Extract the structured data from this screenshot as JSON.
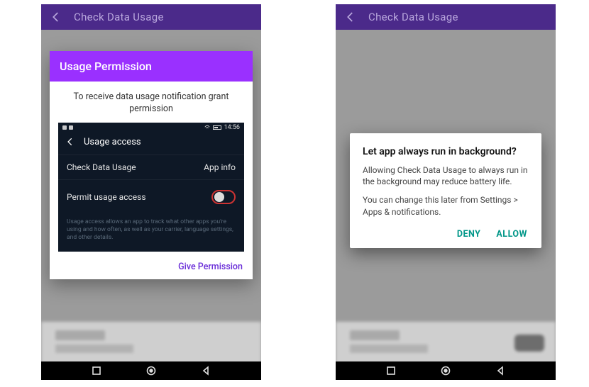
{
  "appbar": {
    "title": "Check Data Usage"
  },
  "left": {
    "dialog": {
      "title": "Usage Permission",
      "description": "To receive data usage notification grant permission",
      "action_label": "Give Permission"
    },
    "embed": {
      "status_time": "14:56",
      "appbar_title": "Usage access",
      "row1_left": "Check Data Usage",
      "row1_right": "App info",
      "row2_left": "Permit usage access",
      "fineprint": "Usage access allows an app to track what other apps you're using and how often, as well as your carrier, language settings, and other details."
    }
  },
  "right": {
    "dialog": {
      "title": "Let app always run in background?",
      "body1": "Allowing Check Data Usage to always run in the background may reduce battery life.",
      "body2": "You can change this later from Settings > Apps & notifications.",
      "deny": "DENY",
      "allow": "ALLOW"
    }
  }
}
